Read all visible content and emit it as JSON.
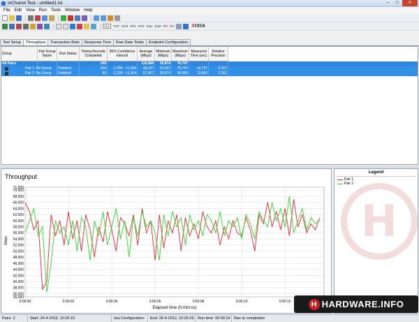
{
  "window": {
    "title": "IxChariot Test - untitled1.tst",
    "minimize": "–",
    "maximize": "□",
    "close": "✕"
  },
  "menu": [
    "File",
    "Edit",
    "View",
    "Run",
    "Tools",
    "Window",
    "Help"
  ],
  "toolbar": {
    "protocols": [
      "ALL",
      "TCP",
      "SCR",
      "EP1",
      "EP2",
      "EQ1",
      "EQ2",
      "PG",
      "PC"
    ],
    "brand": {
      "x": "X",
      "rest": "IXIA"
    }
  },
  "tabs": [
    "Test Setup",
    "Throughput",
    "Transaction Rate",
    "Response Time",
    "Raw Data Totals",
    "Endpoint Configuration"
  ],
  "active_tab": "Throughput",
  "grid": {
    "columns": [
      "Group",
      "Pair Group Name",
      "Run Status",
      "Timing Records Completed",
      "95% Confidence Interval",
      "Average (Mbps)",
      "Minimum (Mbps)",
      "Maximum (Mbps)",
      "Measured Time (sec)",
      "Relative Precision"
    ],
    "all_pairs": {
      "label": "All Pairs",
      "timing_records": "199",
      "average": "115,484",
      "minimum": "35,874",
      "maximum": "70,797"
    },
    "rows": [
      {
        "pair": "Pair 1: No Group",
        "status": "Finished",
        "timing_records": "100",
        "confidence": "-1,256 : +1,256",
        "average": "58,237",
        "minimum": "37,037",
        "maximum": "70,797",
        "measured_time": "13,737",
        "precision": "2,157"
      },
      {
        "pair": "Pair 2: No Group",
        "status": "Finished",
        "timing_records": "99",
        "confidence": "-1,334 : +1,334",
        "average": "57,967",
        "minimum": "35,874",
        "maximum": "69,565",
        "measured_time": "13,663",
        "precision": "2,301"
      }
    ]
  },
  "legend": {
    "title": "Legend"
  },
  "chart_data": {
    "type": "line",
    "title": "Throughput",
    "xlabel": "Elapsed time (h:mm:ss)",
    "ylabel": "Mbps",
    "x_ticks": [
      "0:00:00",
      "0:00:02",
      "0:00:04",
      "0:00:06",
      "0:00:08",
      "0:00:10",
      "0:00:12"
    ],
    "y_ticks": [
      "35,000",
      "36,000",
      "38,000",
      "40,000",
      "42,000",
      "44,000",
      "46,000",
      "48,000",
      "50,000",
      "52,000",
      "54,000",
      "56,000",
      "58,000",
      "60,000",
      "62,000",
      "64,000",
      "66,000",
      "68,000",
      "70,000",
      "71,000"
    ],
    "xlim": [
      0,
      13.8
    ],
    "ylim": [
      35000,
      71000
    ],
    "grid": true,
    "legend_position": "right",
    "series": [
      {
        "name": "Pair 1",
        "color": "#e8252f",
        "x": [
          0,
          0.2,
          0.4,
          0.6,
          0.8,
          1,
          1.2,
          1.4,
          1.6,
          1.8,
          2,
          2.2,
          2.4,
          2.6,
          2.8,
          3,
          3.2,
          3.4,
          3.6,
          3.8,
          4,
          4.2,
          4.4,
          4.6,
          4.8,
          5,
          5.2,
          5.4,
          5.6,
          5.8,
          6,
          6.2,
          6.4,
          6.6,
          6.8,
          7,
          7.2,
          7.4,
          7.6,
          7.8,
          8,
          8.2,
          8.4,
          8.6,
          8.8,
          9,
          9.2,
          9.4,
          9.6,
          9.8,
          10,
          10.2,
          10.4,
          10.6,
          10.8,
          11,
          11.2,
          11.4,
          11.6,
          11.8,
          12,
          12.2,
          12.4,
          12.6,
          12.8,
          13,
          13.2,
          13.4,
          13.6
        ],
        "values": [
          66000,
          63000,
          57000,
          60000,
          37500,
          40000,
          62000,
          55000,
          60000,
          52000,
          63000,
          54000,
          60000,
          50000,
          62000,
          57000,
          48000,
          58000,
          53000,
          63000,
          57000,
          50000,
          61000,
          59000,
          55000,
          62000,
          52000,
          64000,
          56000,
          60000,
          47000,
          62000,
          51000,
          60000,
          56000,
          62000,
          50000,
          61000,
          55000,
          59000,
          54000,
          63000,
          58000,
          56000,
          60000,
          52000,
          58000,
          54000,
          60000,
          56000,
          55000,
          61000,
          57000,
          50000,
          62000,
          59000,
          66000,
          58000,
          63000,
          57000,
          64000,
          55000,
          67000,
          58000,
          62000,
          56000,
          59000,
          57000,
          61000
        ]
      },
      {
        "name": "Pair 2",
        "color": "#2bd62b",
        "x": [
          0,
          0.2,
          0.4,
          0.6,
          0.8,
          1,
          1.2,
          1.4,
          1.6,
          1.8,
          2,
          2.2,
          2.4,
          2.6,
          2.8,
          3,
          3.2,
          3.4,
          3.6,
          3.8,
          4,
          4.2,
          4.4,
          4.6,
          4.8,
          5,
          5.2,
          5.4,
          5.6,
          5.8,
          6,
          6.2,
          6.4,
          6.6,
          6.8,
          7,
          7.2,
          7.4,
          7.6,
          7.8,
          8,
          8.2,
          8.4,
          8.6,
          8.8,
          9,
          9.2,
          9.4,
          9.6,
          9.8,
          10,
          10.2,
          10.4,
          10.6,
          10.8,
          11,
          11.2,
          11.4,
          11.6,
          11.8,
          12,
          12.2,
          12.4,
          12.6,
          12.8,
          13,
          13.2,
          13.4,
          13.6
        ],
        "values": [
          56000,
          60000,
          64000,
          55000,
          58000,
          36500,
          46000,
          60000,
          56000,
          58000,
          52000,
          60000,
          50000,
          61000,
          58000,
          47000,
          60000,
          55000,
          63000,
          52000,
          58000,
          64000,
          54000,
          60000,
          48000,
          61000,
          55000,
          63000,
          58000,
          60000,
          56000,
          47000,
          62000,
          55000,
          63000,
          58000,
          61000,
          52000,
          62000,
          57000,
          60000,
          55000,
          62000,
          60000,
          56000,
          63000,
          55000,
          60000,
          58000,
          61000,
          54000,
          62000,
          59000,
          54000,
          63000,
          60000,
          58000,
          66000,
          60000,
          64000,
          58000,
          68000,
          56000,
          60000,
          64000,
          57000,
          61000,
          59000,
          60000
        ]
      }
    ]
  },
  "watermark": {
    "letter": "H"
  },
  "brand_logo": {
    "circle": "H",
    "text": "HARDWARE.INFO"
  },
  "status": {
    "pairs": "Pairs: 2",
    "start": "Start: 26-4-2012, 10:26:15",
    "ixia_config": "Ixia Configuration:",
    "end": "End: 26-4-2012, 10:26:29",
    "run_time": "Run time: 00:00:14",
    "completion": "Ran to completion"
  }
}
